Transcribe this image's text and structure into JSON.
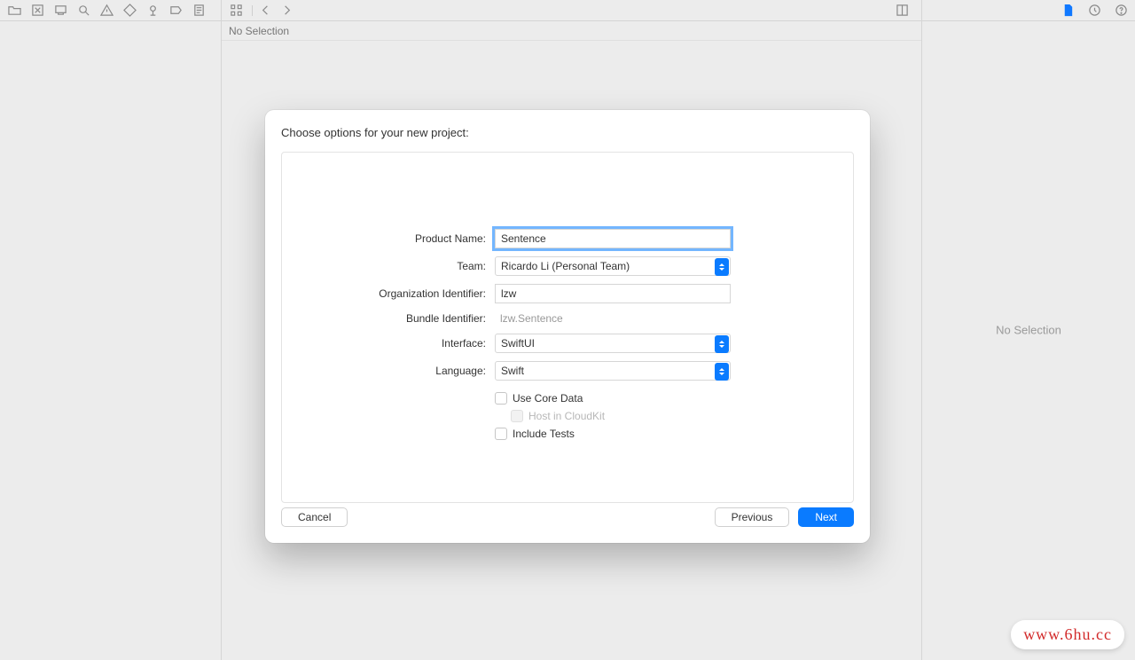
{
  "editor": {
    "no_selection_mid": "No Selection",
    "no_selection_right": "No Selection"
  },
  "sheet": {
    "title": "Choose options for your new project:",
    "labels": {
      "product_name": "Product Name:",
      "team": "Team:",
      "org_id": "Organization Identifier:",
      "bundle_id": "Bundle Identifier:",
      "interface": "Interface:",
      "language": "Language:"
    },
    "values": {
      "product_name": "Sentence",
      "team": "Ricardo Li (Personal Team)",
      "org_id": "lzw",
      "bundle_id": "lzw.Sentence",
      "interface": "SwiftUI",
      "language": "Swift"
    },
    "checks": {
      "core_data": "Use Core Data",
      "cloudkit": "Host in CloudKit",
      "tests": "Include Tests"
    },
    "buttons": {
      "cancel": "Cancel",
      "previous": "Previous",
      "next": "Next"
    }
  },
  "watermark": "www.6hu.cc"
}
